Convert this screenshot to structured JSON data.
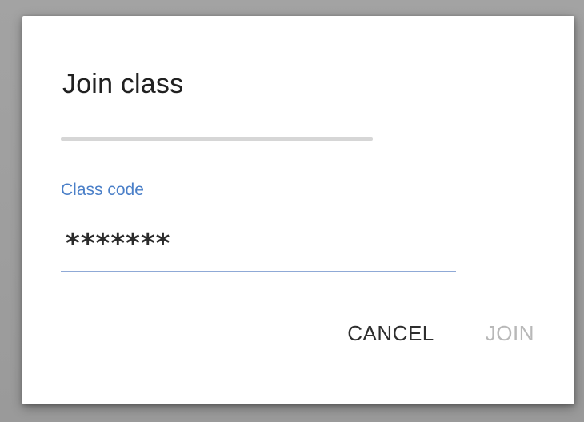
{
  "dialog": {
    "title": "Join class",
    "field": {
      "label": "Class code",
      "value": "*******"
    },
    "actions": {
      "cancel_label": "CANCEL",
      "join_label": "JOIN"
    }
  },
  "colors": {
    "label_accent": "#4a7fc8",
    "disabled_text": "#b8b8b8",
    "primary_text": "#212121"
  }
}
